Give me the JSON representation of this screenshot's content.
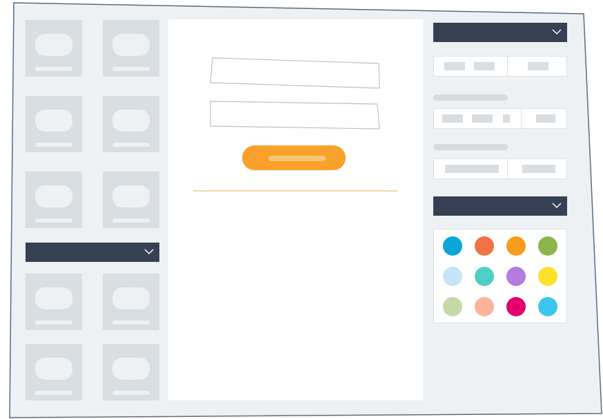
{
  "palette": {
    "swatches": [
      "#0aa6da",
      "#f27146",
      "#f89c1c",
      "#8cb64a",
      "#c2e6f6",
      "#50cfc7",
      "#b57be0",
      "#fbe32d",
      "#c5d8a7",
      "#fbb49a",
      "#e3006d",
      "#3cc5ef"
    ]
  },
  "colors": {
    "accent": "#f9a12a",
    "header": "#354052",
    "frame_bg": "#eef1f3",
    "placeholder": "#d9dee2"
  },
  "icons": {
    "dropdown": "chevron-down-icon"
  }
}
